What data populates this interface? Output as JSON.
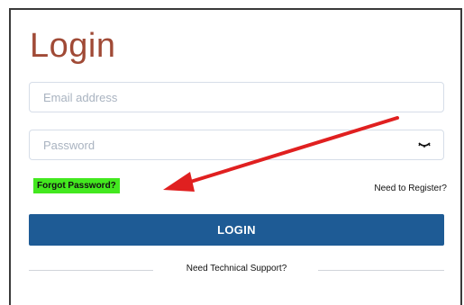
{
  "form": {
    "title": "Login",
    "email_placeholder": "Email address",
    "password_placeholder": "Password",
    "forgot_label": "Forgot Password?",
    "register_label": "Need to Register?",
    "login_label": "LOGIN",
    "support_label": "Need Technical Support?"
  },
  "icons": {
    "password_toggle": "eye-icon",
    "annotation": "red-arrow"
  },
  "colors": {
    "title": "#a04a36",
    "login_button": "#1e5b95",
    "forgot_highlight": "#43e81f",
    "arrow": "#e02020"
  }
}
